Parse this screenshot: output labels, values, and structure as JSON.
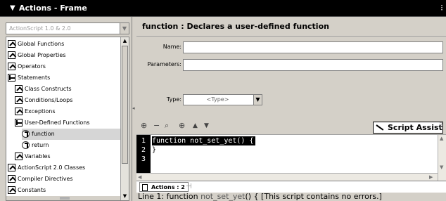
{
  "panel": {
    "title": "Actions - Frame",
    "collapse_glyph": "▼",
    "options_glyph": "⁝"
  },
  "toolbox": {
    "version_select": "ActionScript 1.0 & 2.0",
    "items": [
      {
        "label": "Global Functions",
        "icon": "book-icon",
        "selected": false
      },
      {
        "label": "Global Properties",
        "icon": "book-icon",
        "selected": false
      },
      {
        "label": "Operators",
        "icon": "book-icon",
        "selected": false
      },
      {
        "label": "Statements",
        "icon": "open-book-icon",
        "selected": false
      },
      {
        "label": "Class Constructs",
        "icon": "book-icon",
        "selected": false
      },
      {
        "label": "Conditions/Loops",
        "icon": "book-icon",
        "selected": false
      },
      {
        "label": "Exceptions",
        "icon": "book-icon",
        "selected": false
      },
      {
        "label": "User-Defined Functions",
        "icon": "open-book-icon",
        "selected": false
      },
      {
        "label": "function",
        "icon": "function-icon",
        "selected": true
      },
      {
        "label": "return",
        "icon": "function-icon",
        "selected": false
      },
      {
        "label": "Variables",
        "icon": "book-icon",
        "selected": false
      },
      {
        "label": "ActionScript 2.0 Classes",
        "icon": "book-icon",
        "selected": false
      },
      {
        "label": "Compiler Directives",
        "icon": "book-icon",
        "selected": false
      },
      {
        "label": "Constants",
        "icon": "book-icon",
        "selected": false
      }
    ]
  },
  "description": "function : Declares a user-defined function",
  "params": {
    "name_label": "Name:",
    "name_value": "",
    "parameters_label": "Parameters:",
    "parameters_value": "",
    "type_label": "Type:",
    "type_value": "<Type>"
  },
  "toolbar": {
    "add_glyph": "⊕",
    "remove_glyph": "−",
    "find_glyph": "⌕",
    "target_glyph": "⊕",
    "up_glyph": "▲",
    "down_glyph": "▼",
    "script_assist_label": "Script Assist",
    "help_glyph": "?"
  },
  "editor": {
    "lines": [
      {
        "num": "1",
        "code": "function not_set_yet() {"
      },
      {
        "num": "2",
        "code": "}"
      },
      {
        "num": "3",
        "code": ""
      }
    ]
  },
  "tabs": {
    "active": "Actions : 2",
    "pin_glyph": "⊣"
  },
  "status": {
    "prefix": "Line 1: function ",
    "dim1": "not_set_yet",
    "suffix": "() { [This script contains no errors.]"
  }
}
